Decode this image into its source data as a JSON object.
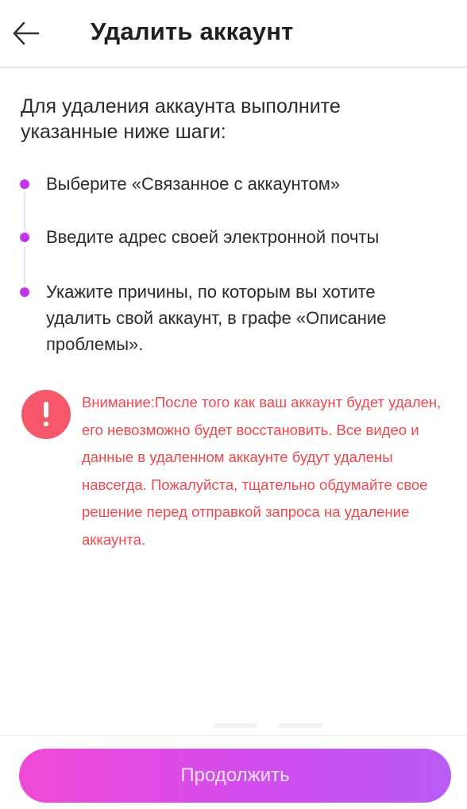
{
  "header": {
    "title": "Удалить аккаунт",
    "back_icon": "arrow-left-icon"
  },
  "intro": "Для удаления аккаунта выполните указанные ниже шаги:",
  "steps": [
    {
      "text": "Выберите «Связанное с аккаунтом»"
    },
    {
      "text": "Введите адрес своей электронной почты"
    },
    {
      "text": "Укажите причины, по которым вы хотите удалить свой аккаунт, в графе «Описание проблемы»."
    }
  ],
  "warning": {
    "icon": "exclamation-icon",
    "text": "Внимание:После того как ваш аккаунт будет удален, его невозможно будет восстановить. Все видео и данные в удаленном аккаунте будут удалены навсегда. Пожалуйста, тщательно обдумайте свое решение перед отправкой запроса на удаление аккаунта."
  },
  "footer": {
    "continue_label": "Продолжить"
  },
  "colors": {
    "accent": "#c433ee",
    "warning": "#f0474e",
    "button_gradient_start": "#f04ad6",
    "button_gradient_end": "#b85cf3"
  }
}
